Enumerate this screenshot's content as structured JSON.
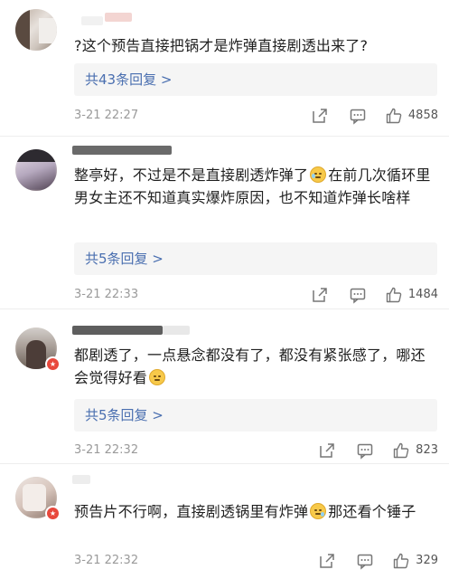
{
  "comments": [
    {
      "text": "?这个预告直接把锅才是炸弹直接剧透出来了?",
      "replies_label": "共43条回复 >",
      "time": "3-21 22:27",
      "likes": "4858"
    },
    {
      "text_before": "整亭好，不过是不是直接剧透炸弹了",
      "text_after": "在前几次循环里男女主还不知道真实爆炸原因，也不知道炸弹长啥样",
      "replies_label": "共5条回复 >",
      "time": "3-21 22:33",
      "likes": "1484"
    },
    {
      "text": "都剧透了，一点悬念都没有了，都没有紧张感了，哪还会觉得好看",
      "replies_label": "共5条回复 >",
      "time": "3-21 22:32",
      "likes": "823"
    },
    {
      "text_before": "预告片不行啊，直接剧透锅里有炸弹",
      "text_after": "那还看个锤子",
      "time": "3-21 22:32",
      "likes": "329"
    }
  ],
  "icons": {
    "share": "share-icon",
    "comment": "comment-icon",
    "like": "thumbs-up-icon",
    "laugh": "laughing-emoji-icon",
    "tear": "tear-emoji-icon"
  },
  "colors": {
    "reply_link": "#4a6fb0",
    "reply_bg": "#f5f5f5",
    "meta_gray": "#9a9a9a",
    "badge_red": "#e8483c"
  }
}
